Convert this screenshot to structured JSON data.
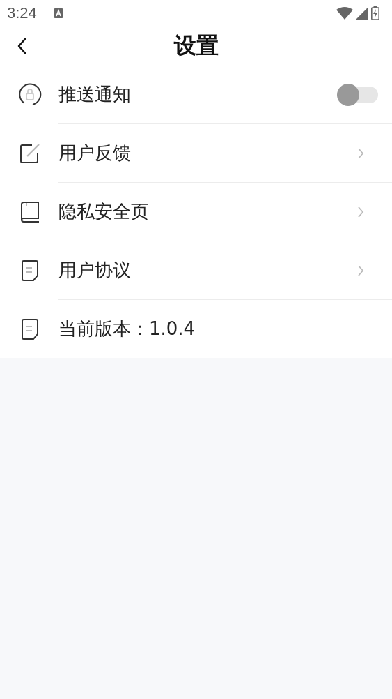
{
  "status_bar": {
    "time": "3:24"
  },
  "header": {
    "title": "设置"
  },
  "items": [
    {
      "kind": "toggle",
      "label": "推送通知",
      "on": false
    },
    {
      "kind": "link",
      "label": "用户反馈"
    },
    {
      "kind": "link",
      "label": "隐私安全页"
    },
    {
      "kind": "link",
      "label": "用户协议"
    },
    {
      "kind": "plain",
      "label": "当前版本：1.0.4"
    }
  ]
}
